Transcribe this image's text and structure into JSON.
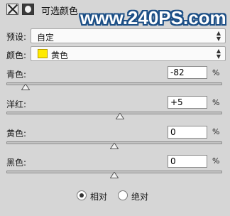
{
  "header": {
    "title": "可选颜色",
    "watermark": "www.240PS.com",
    "adjust_icon": "adjustment-layer-icon",
    "mask_icon": "layer-mask-icon"
  },
  "preset": {
    "label": "预设:",
    "value": "自定"
  },
  "colors": {
    "label": "颜色:",
    "value": "黄色",
    "swatch_color": "#ffea00"
  },
  "channels": [
    {
      "label": "青色:",
      "value": "-82",
      "unit": "%",
      "level": -82
    },
    {
      "label": "洋红:",
      "value": "+5",
      "unit": "%",
      "level": 5
    },
    {
      "label": "黄色:",
      "value": "0",
      "unit": "%",
      "level": 0
    },
    {
      "label": "黑色:",
      "value": "0",
      "unit": "%",
      "level": 0
    }
  ],
  "method": {
    "options": [
      {
        "label": "相对",
        "selected": true
      },
      {
        "label": "绝对",
        "selected": false
      }
    ]
  }
}
